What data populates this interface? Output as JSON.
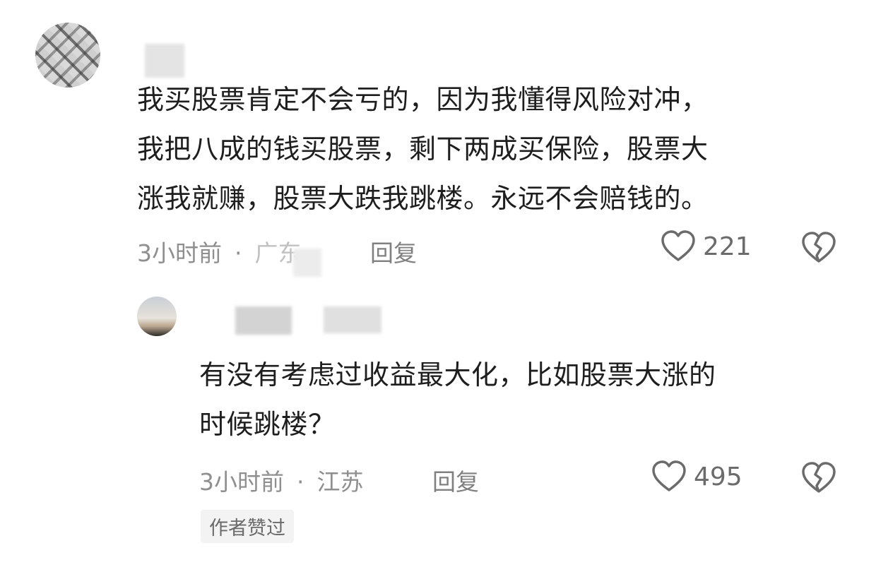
{
  "comments": [
    {
      "avatar_icon": "user-avatar-icon",
      "text_lines": [
        "我买股票肯定不会亏的，因为我懂得风险对冲，",
        "我把八成的钱买股票，剩下两成买保险，股票大",
        "涨我就赚，股票大跌我跳楼。永远不会赔钱的。"
      ],
      "time": "3小时前",
      "separator": "·",
      "location": "广东",
      "reply_label": "回复",
      "like_count": "221",
      "like_icon": "heart-icon",
      "dislike_icon": "broken-heart-icon"
    },
    {
      "avatar_icon": "user-avatar-icon",
      "text_lines": [
        "有没有考虑过收益最大化，比如股票大涨的",
        "时候跳楼？"
      ],
      "time": "3小时前",
      "separator": "·",
      "location": "江苏",
      "reply_label": "回复",
      "like_count": "495",
      "like_icon": "heart-icon",
      "dislike_icon": "broken-heart-icon",
      "badge": "作者赞过"
    }
  ],
  "colors": {
    "text": "#1e1e1e",
    "meta": "#8f8f8f",
    "badge_bg": "#f3f3f3"
  }
}
